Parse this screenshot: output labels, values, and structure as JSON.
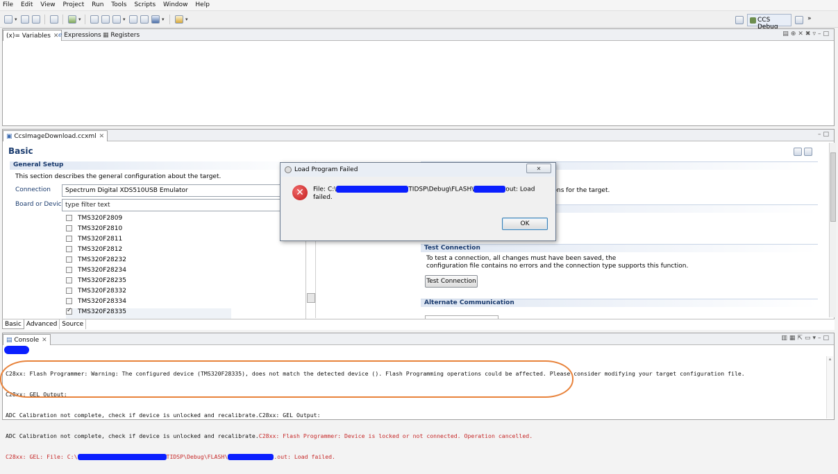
{
  "menubar": {
    "items": [
      "File",
      "Edit",
      "View",
      "Project",
      "Run",
      "Tools",
      "Scripts",
      "Window",
      "Help"
    ]
  },
  "perspective": {
    "label": "CCS Debug",
    "more": "»"
  },
  "variables_view": {
    "tabs": [
      {
        "label": "Variables",
        "prefix": "(x)="
      },
      {
        "label": "Expressions"
      },
      {
        "label": "Registers"
      }
    ]
  },
  "editor": {
    "tab_label": "CcsImageDownload.ccxml",
    "page_title": "Basic",
    "general_setup": {
      "header": "General Setup",
      "description": "This section describes the general configuration about the target.",
      "connection_label": "Connection",
      "connection_value": "Spectrum Digital XDS510USB Emulator",
      "board_label": "Board or Device",
      "filter_value": "type filter text"
    },
    "devices": [
      {
        "name": "TMS320F2809",
        "checked": false
      },
      {
        "name": "TMS320F2810",
        "checked": false
      },
      {
        "name": "TMS320F2811",
        "checked": false
      },
      {
        "name": "TMS320F2812",
        "checked": false
      },
      {
        "name": "TMS320F28232",
        "checked": false
      },
      {
        "name": "TMS320F28234",
        "checked": false
      },
      {
        "name": "TMS320F28235",
        "checked": false
      },
      {
        "name": "TMS320F28332",
        "checked": false
      },
      {
        "name": "TMS320F28334",
        "checked": false
      },
      {
        "name": "TMS320F28335",
        "checked": true
      }
    ],
    "right": {
      "advanced_text_fragment": "ions for the target.",
      "test_connection_header": "Test Connection",
      "test_connection_line1": "To test a connection, all changes must have been saved, the",
      "test_connection_line2": "configuration file contains no errors and the connection type supports this function.",
      "test_connection_button": "Test Connection",
      "alternate_header": "Alternate Communication"
    },
    "bottom_tabs": [
      "Basic",
      "Advanced",
      "Source"
    ]
  },
  "dialog": {
    "title": "Load Program Failed",
    "message_prefix": "File: C:\\",
    "message_middle": "TIDSP\\Debug\\FLASH\\",
    "message_suffix": "out: Load",
    "message_line2": "failed.",
    "ok_label": "OK"
  },
  "console": {
    "tab_label": "Console",
    "lines": [
      {
        "segments": [
          {
            "text": "C28xx: Flash Programmer: Warning: The configured device (TMS320F28335), does not match the detected device (). Flash Programming operations could be affected. Please consider modifying your target configuration file.",
            "color": "black"
          }
        ]
      },
      {
        "segments": [
          {
            "text": "C28xx: GEL Output:",
            "color": "black"
          }
        ]
      },
      {
        "segments": [
          {
            "text": "ADC Calibration not complete, check if device is unlocked and recalibrate.C28xx: GEL Output:",
            "color": "black"
          }
        ]
      },
      {
        "segments": [
          {
            "text": "ADC Calibration not complete, check if device is unlocked and recalibrate.",
            "color": "black"
          },
          {
            "text": "C28xx: Flash Programmer: Device is locked or not connected. Operation cancelled.",
            "color": "red"
          }
        ]
      },
      {
        "segments": [
          {
            "text": "C28xx: GEL: File: C:\\",
            "color": "red"
          },
          {
            "text": "TIDSP\\Debug\\FLASH\\",
            "color": "red"
          },
          {
            "text": ".out: Load failed.",
            "color": "red"
          }
        ]
      }
    ]
  },
  "colors": {
    "accent": "#1a3b6e",
    "error_red": "#c62828",
    "redaction_blue": "#0a1fff",
    "annotation_orange": "#e8823a"
  }
}
